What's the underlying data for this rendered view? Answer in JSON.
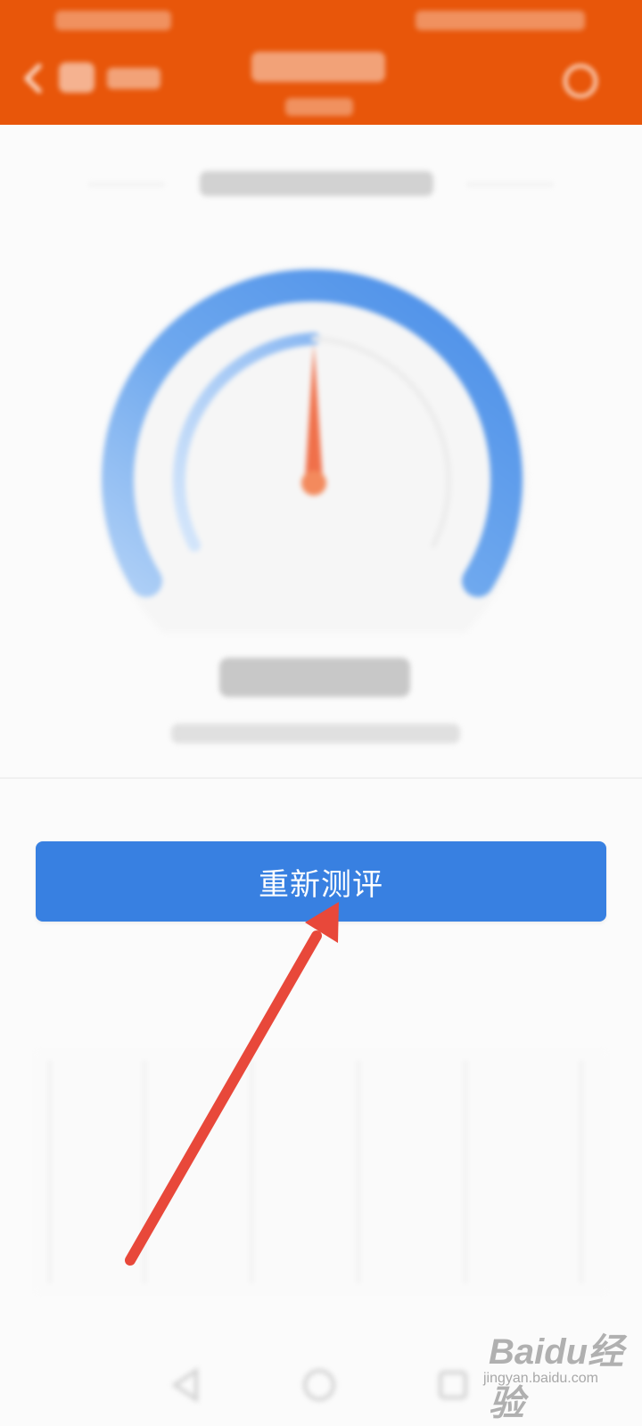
{
  "colors": {
    "header_bg": "#e8560a",
    "accent_blue": "#3880e1",
    "needle_red": "#f0704a",
    "annotation_arrow": "#e8483a"
  },
  "header": {
    "back_icon": "chevron-left-icon",
    "refresh_icon": "refresh-icon"
  },
  "gauge": {
    "needle_level": 0.5
  },
  "actions": {
    "reassess_label": "重新测评"
  },
  "navbar": {
    "icons": [
      "back-triangle-icon",
      "home-circle-icon",
      "recents-square-icon"
    ]
  },
  "watermark": {
    "brand": "Baidu经验",
    "url": "jingyan.baidu.com"
  }
}
